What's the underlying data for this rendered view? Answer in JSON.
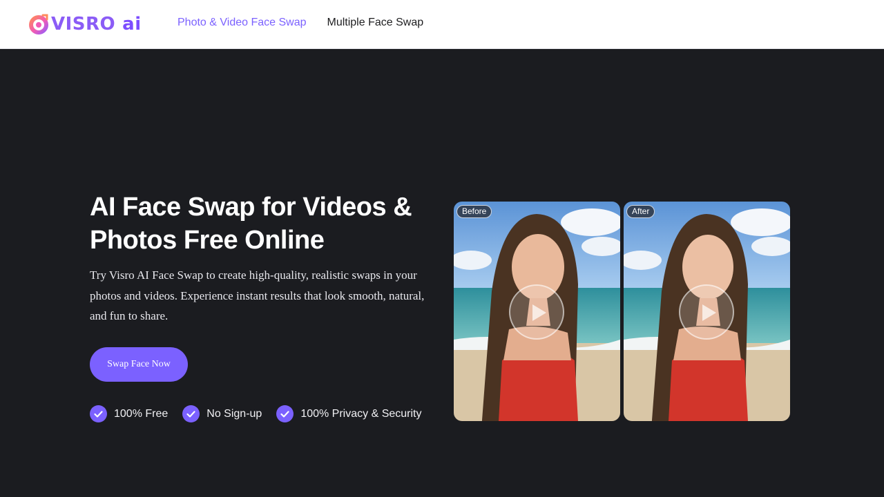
{
  "brand": {
    "name": "VISRO",
    "suffix": "ai",
    "colors": {
      "primary": "#7b61ff",
      "logo_pink": "#f15bb5",
      "logo_orange": "#ff8a5b"
    }
  },
  "nav": {
    "items": [
      {
        "label": "Photo & Video Face Swap",
        "active": true
      },
      {
        "label": "Multiple Face Swap",
        "active": false
      }
    ]
  },
  "hero": {
    "title": "AI Face Swap for Videos & Photos Free Online",
    "description": "Try Visro AI Face Swap to create high-quality, realistic swaps in your photos and videos. Experience instant results that look smooth, natural, and fun to share.",
    "cta_label": "Swap Face Now"
  },
  "features": [
    {
      "label": "100% Free",
      "icon": "check-icon"
    },
    {
      "label": "No Sign-up",
      "icon": "check-icon"
    },
    {
      "label": "100% Privacy & Security",
      "icon": "check-icon"
    }
  ],
  "preview": {
    "before_label": "Before",
    "after_label": "After",
    "play_icon": "play-icon"
  }
}
